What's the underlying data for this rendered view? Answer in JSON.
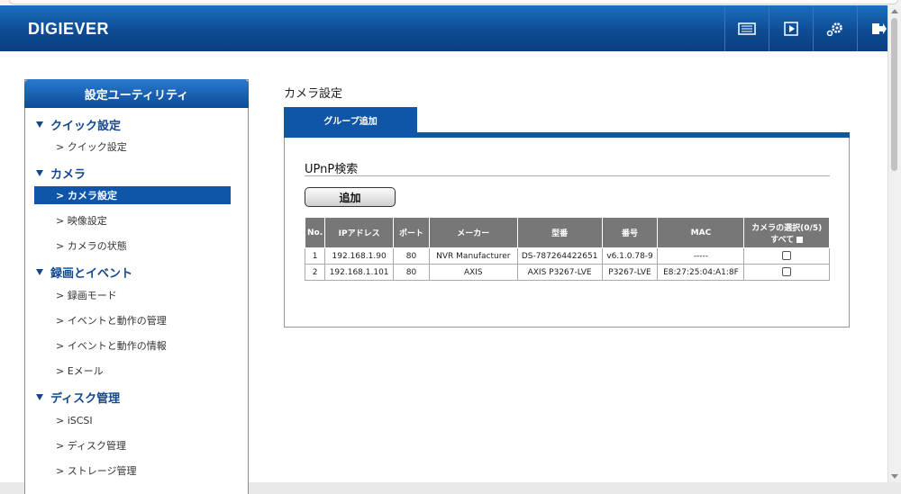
{
  "header": {
    "logo": "DIGIEVER"
  },
  "header_icons": [
    "monitor-icon",
    "play-icon",
    "settings-icon",
    "logout-icon"
  ],
  "sidebar": {
    "title": "設定ユーティリティ",
    "sections": [
      {
        "label": "クイック設定",
        "items": [
          {
            "label": "> クイック設定"
          }
        ]
      },
      {
        "label": "カメラ",
        "items": [
          {
            "label": "> カメラ設定",
            "active": true
          },
          {
            "label": "> 映像設定"
          },
          {
            "label": "> カメラの状態"
          }
        ]
      },
      {
        "label": "録画とイベント",
        "items": [
          {
            "label": "> 録画モード"
          },
          {
            "label": "> イベントと動作の管理"
          },
          {
            "label": "> イベントと動作の情報"
          },
          {
            "label": "> Eメール"
          }
        ]
      },
      {
        "label": "ディスク管理",
        "items": [
          {
            "label": "> iSCSI"
          },
          {
            "label": "> ディスク管理"
          },
          {
            "label": "> ストレージ管理"
          }
        ]
      }
    ]
  },
  "main": {
    "title": "カメラ設定",
    "tab": "グループ追加",
    "upnp_title": "UPnP検索",
    "add_button": "追加",
    "table": {
      "headers": {
        "no": "No.",
        "ip": "IPアドレス",
        "port": "ポート",
        "maker": "メーカー",
        "model": "型番",
        "version": "番号",
        "mac": "MAC",
        "select": "カメラの選択(0/5)",
        "select_all": "すべて"
      },
      "rows": [
        {
          "no": "1",
          "ip": "192.168.1.90",
          "port": "80",
          "maker": "NVR Manufacturer",
          "model": "DS-787264422651",
          "version": "v6.1.0.78-9",
          "mac": "-----"
        },
        {
          "no": "2",
          "ip": "192.168.1.101",
          "port": "80",
          "maker": "AXIS",
          "model": "AXIS P3267-LVE",
          "version": "P3267-LVE",
          "mac": "E8:27:25:04:A1:8F"
        }
      ]
    }
  },
  "colors": {
    "brand_blue": "#0f56a8",
    "header_gradient_top": "#1b6fc0",
    "table_header": "#777777"
  }
}
